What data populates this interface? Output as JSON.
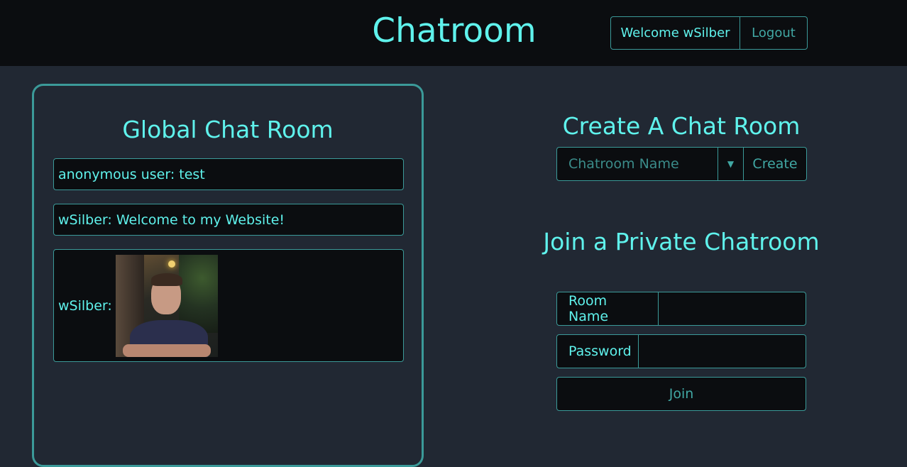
{
  "header": {
    "title": "Chatroom",
    "welcome_label": "Welcome wSilber",
    "logout_label": "Logout"
  },
  "global_chat": {
    "title": "Global Chat Room",
    "messages": [
      {
        "text": "anonymous user: test"
      },
      {
        "text": "wSilber: Welcome to my Website!"
      },
      {
        "sender": "wSilber:",
        "type": "image"
      }
    ]
  },
  "create_room": {
    "title": "Create A Chat Room",
    "name_placeholder": "Chatroom Name",
    "create_label": "Create"
  },
  "join_private": {
    "title": "Join a Private Chatroom",
    "room_name_label": "Room Name",
    "password_label": "Password",
    "join_label": "Join"
  },
  "colors": {
    "accent": "#5ff2ec",
    "border": "#3b9a99",
    "background": "#212833",
    "header_bg": "#0b0d10"
  }
}
